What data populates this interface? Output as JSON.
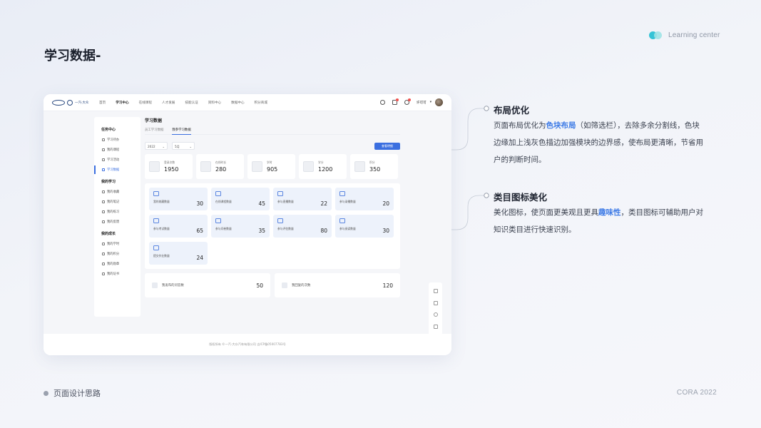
{
  "brand": {
    "text": "Learning center"
  },
  "page": {
    "title": "学习数据-"
  },
  "app": {
    "logo_text": "一汽·大众",
    "nav": [
      "首页",
      "学习中心",
      "在线课程",
      "人才发展",
      "技能认证",
      "资料中心",
      "数据中心",
      "积分商城"
    ],
    "nav_active": 1,
    "user_name": "许可可",
    "sidebar": {
      "groups": [
        {
          "title": "任务中心",
          "items": [
            "学习待办",
            "我的课程",
            "学习活动",
            "学习数据"
          ]
        },
        {
          "title": "我的学习",
          "items": [
            "我的收藏",
            "我的笔记",
            "我的练习",
            "我的反馈"
          ]
        },
        {
          "title": "我的成长",
          "items": [
            "我的学时",
            "我的积分",
            "我的勋章",
            "我的证书"
          ]
        }
      ],
      "active": "学习数据"
    },
    "main_title": "学习数据",
    "tabs": [
      "员工学习数据",
      "我参学习数据"
    ],
    "tab_active": 1,
    "filters": {
      "year": "2022",
      "month": "5月"
    },
    "query_label": "查看明细",
    "stats": [
      {
        "label": "登录次数",
        "value": "1950"
      },
      {
        "label": "在线时长",
        "value": "280"
      },
      {
        "label": "学时",
        "value": "905"
      },
      {
        "label": "学分",
        "value": "1200"
      },
      {
        "label": "积分",
        "value": "350"
      }
    ],
    "categories": [
      {
        "label": "我的收藏数量",
        "value": "30"
      },
      {
        "label": "在线课程数量",
        "value": "45"
      },
      {
        "label": "参与直播数量",
        "value": "22"
      },
      {
        "label": "参与录播数量",
        "value": "20"
      },
      {
        "label": "参与考试数量",
        "value": "65"
      },
      {
        "label": "参与问卷数量",
        "value": "35"
      },
      {
        "label": "参与评估数量",
        "value": "80"
      },
      {
        "label": "参与阅读数量",
        "value": "30"
      },
      {
        "label": "提交作业数量",
        "value": "24"
      }
    ],
    "bottom_cards": [
      {
        "label": "我发布的问答数",
        "value": "50"
      },
      {
        "label": "我回复的次数",
        "value": "120"
      }
    ],
    "footer": "版权所有 ©一汽-大众汽车有限公司    吉ICP备05007783号"
  },
  "annotations": [
    {
      "title": "布局优化",
      "lines": [
        [
          "页面布局优化为",
          {
            "hl": "色块布局"
          },
          "（如筛选栏），去除多余分割线，色块"
        ],
        [
          "边缘加上浅灰色描边加强模块的边界感，使布局更清晰，节省用"
        ],
        [
          "户的判断时间。"
        ]
      ]
    },
    {
      "title": "类目图标美化",
      "lines": [
        [
          "美化图标，使页面更美观且更具",
          {
            "hl": "趣味性"
          },
          "，类目图标可辅助用户对"
        ],
        [
          "知识类目进行快速识别。"
        ]
      ]
    }
  ],
  "footer_left": "页面设计思路",
  "footer_right": "CORA   2022",
  "colors": {
    "accent": "#3e7be6",
    "brand_teal": "#35c3d6"
  }
}
